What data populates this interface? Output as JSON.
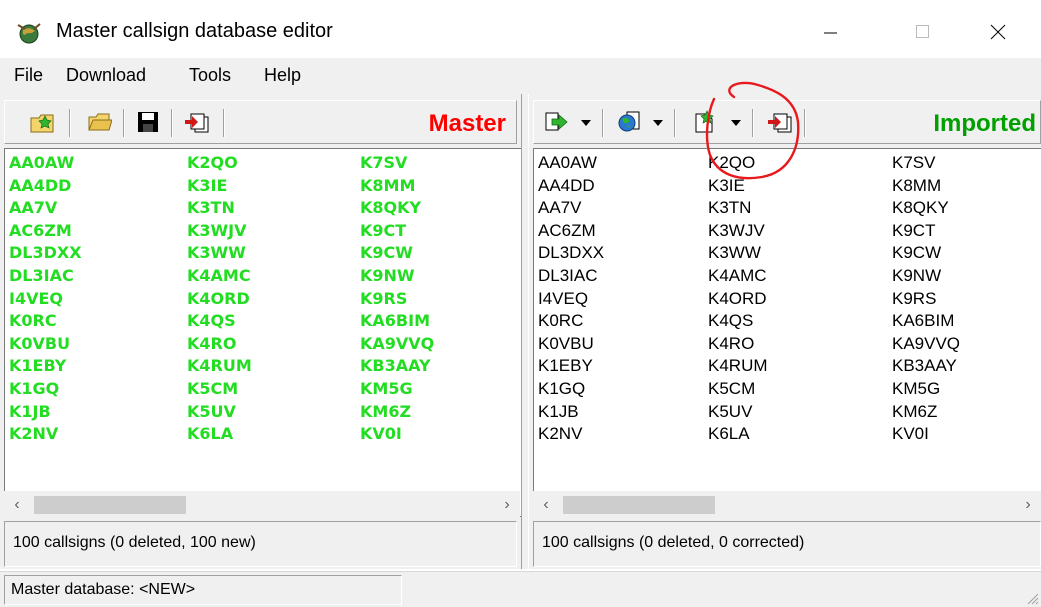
{
  "window": {
    "title": "Master callsign database editor",
    "controls": {
      "minimize": "—",
      "maximize": "☐",
      "close": "✕"
    }
  },
  "menu": [
    {
      "label": "File"
    },
    {
      "label": "Download"
    },
    {
      "label": "Tools"
    },
    {
      "label": "Help"
    }
  ],
  "master": {
    "label": "Master",
    "label_color": "#ff0000",
    "callsign_color": "#22dd22",
    "toolbar_icons": [
      "new-database-icon",
      "open-folder-icon",
      "save-disk-icon",
      "export-icon"
    ],
    "columns": [
      [
        "AA0AW",
        "AA4DD",
        "AA7V",
        "AC6ZM",
        "DL3DXX",
        "DL3IAC",
        "I4VEQ",
        "K0RC",
        "K0VBU",
        "K1EBY",
        "K1GQ",
        "K1JB",
        "K2NV"
      ],
      [
        "K2QO",
        "K3IE",
        "K3TN",
        "K3WJV",
        "K3WW",
        "K4AMC",
        "K4ORD",
        "K4QS",
        "K4RO",
        "K4RUM",
        "K5CM",
        "K5UV",
        "K6LA"
      ],
      [
        "K7SV",
        "K8MM",
        "K8QKY",
        "K9CT",
        "K9CW",
        "K9NW",
        "K9RS",
        "KA6BIM",
        "KA9VVQ",
        "KB3AAY",
        "KM5G",
        "KM6Z",
        "KV0I"
      ]
    ],
    "status": "100 callsigns (0 deleted, 100 new)"
  },
  "imported": {
    "label": "Imported",
    "label_color": "#00a000",
    "toolbar_icons": [
      "import-arrow-icon",
      "web-globe-icon",
      "new-document-icon",
      "export-icon"
    ],
    "columns": [
      [
        "AA0AW",
        "AA4DD",
        "AA7V",
        "AC6ZM",
        "DL3DXX",
        "DL3IAC",
        "I4VEQ",
        "K0RC",
        "K0VBU",
        "K1EBY",
        "K1GQ",
        "K1JB",
        "K2NV"
      ],
      [
        "K2QO",
        "K3IE",
        "K3TN",
        "K3WJV",
        "K3WW",
        "K4AMC",
        "K4ORD",
        "K4QS",
        "K4RO",
        "K4RUM",
        "K5CM",
        "K5UV",
        "K6LA"
      ],
      [
        "K7SV",
        "K8MM",
        "K8QKY",
        "K9CT",
        "K9CW",
        "K9NW",
        "K9RS",
        "KA6BIM",
        "KA9VVQ",
        "KB3AAY",
        "KM5G",
        "KM6Z",
        "KV0I"
      ]
    ],
    "status": "100 callsigns (0 deleted, 0 corrected)"
  },
  "scrollbar": {
    "left_arrow": "‹",
    "right_arrow": "›"
  },
  "statusbar": {
    "text": "Master database: <NEW>"
  },
  "annotation": {
    "color": "#e8191c",
    "shape": "hand-drawn circle"
  }
}
